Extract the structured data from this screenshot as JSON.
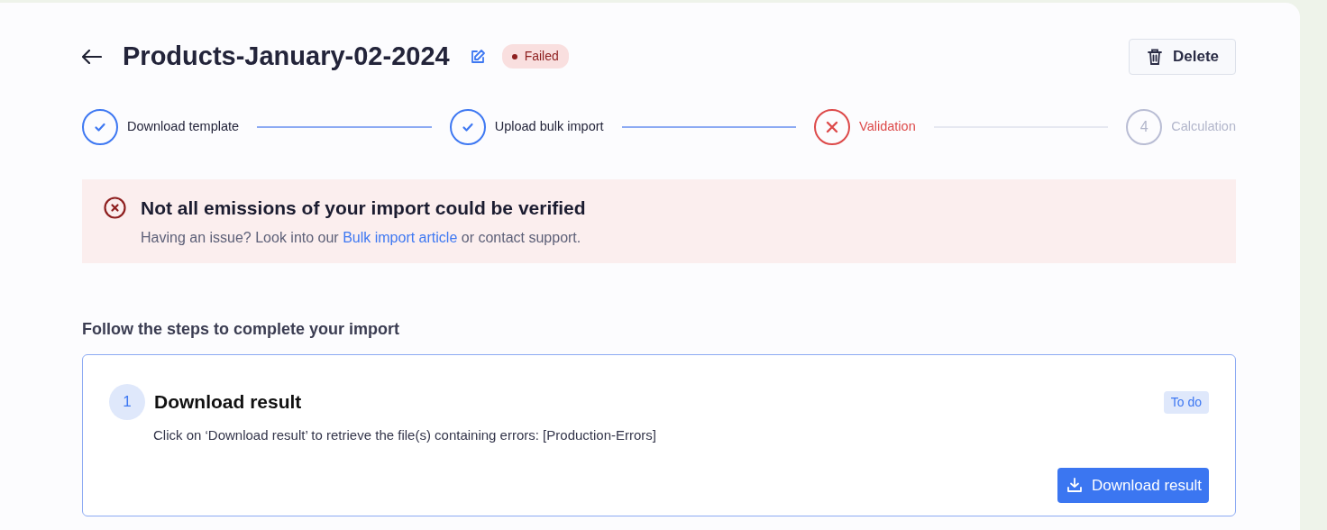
{
  "header": {
    "title": "Products-January-02-2024",
    "status": {
      "label": "Failed",
      "kind": "failed"
    },
    "delete_button": "Delete"
  },
  "stepper": [
    {
      "label": "Download template",
      "kind": "done"
    },
    {
      "label": "Upload bulk import",
      "kind": "done"
    },
    {
      "label": "Validation",
      "kind": "failed"
    },
    {
      "label": "Calculation",
      "kind": "pending",
      "number": "4"
    }
  ],
  "alert": {
    "title": "Not all emissions of your import could be verified",
    "text_before": "Having an issue? Look into our",
    "link": "Bulk import article",
    "text_after": "or contact support."
  },
  "section_title": "Follow the steps to complete your import",
  "tasks": [
    {
      "number": "1",
      "title": "Download result",
      "badge": "To do",
      "description": "Click on ‘Download result’ to retrieve the file(s) containing errors: [Production-Errors]",
      "button": "Download result"
    }
  ]
}
